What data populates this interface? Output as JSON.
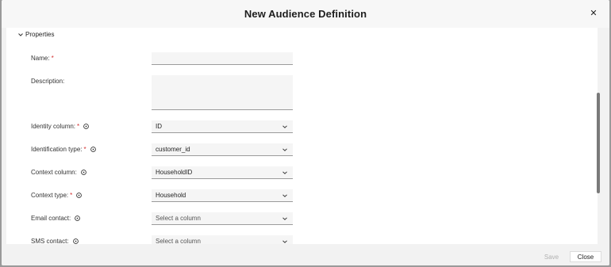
{
  "dialog": {
    "title": "New Audience Definition",
    "close_icon": "close-icon",
    "section_label": "Properties"
  },
  "fields": {
    "name": {
      "label": "Name:",
      "required_mark": "*",
      "value": ""
    },
    "description": {
      "label": "Description:",
      "value": ""
    },
    "identity_column": {
      "label": "Identity column:",
      "required_mark": "*",
      "value": "ID"
    },
    "identification_type": {
      "label": "Identification type:",
      "required_mark": "*",
      "value": "customer_id"
    },
    "context_column": {
      "label": "Context column:",
      "value": "HouseholdID"
    },
    "context_type": {
      "label": "Context type:",
      "required_mark": "*",
      "value": "Household"
    },
    "email_contact": {
      "label": "Email contact:",
      "value": "Select a column"
    },
    "sms_contact": {
      "label": "SMS contact:",
      "value": "Select a column"
    }
  },
  "footer": {
    "save_label": "Save",
    "close_label": "Close"
  },
  "colors": {
    "required": "#d32f2f",
    "field_bg": "#f5f5f5",
    "disabled_text": "#b0b0b0"
  }
}
